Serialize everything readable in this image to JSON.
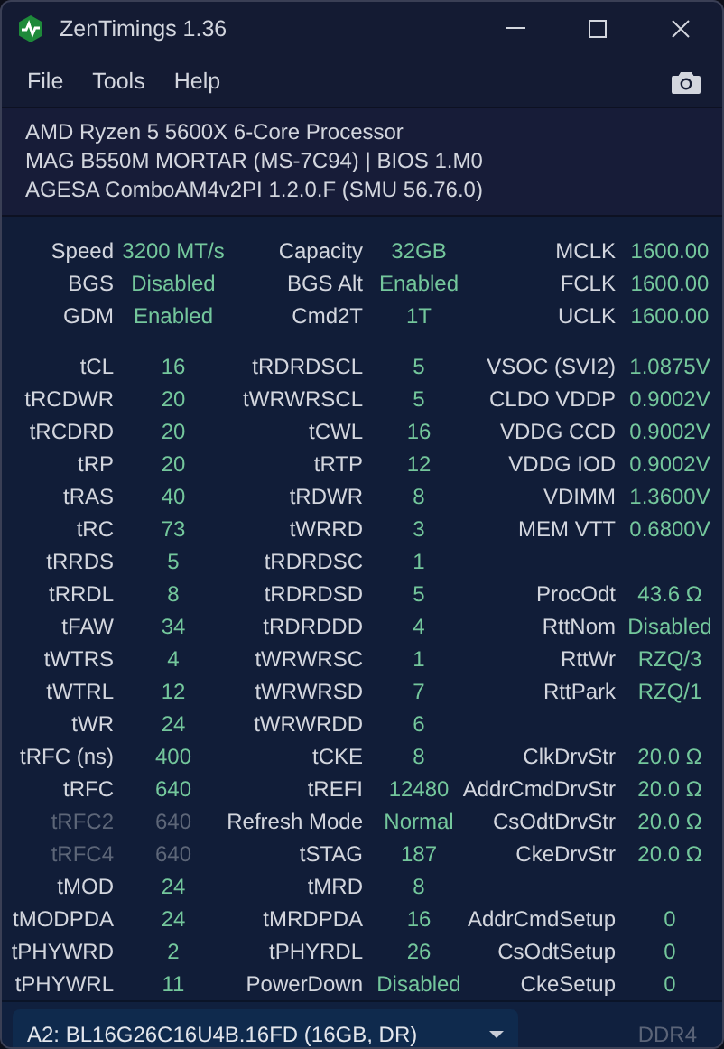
{
  "window": {
    "title": "ZenTimings 1.36"
  },
  "menu": [
    "File",
    "Tools",
    "Help"
  ],
  "system_info": [
    "AMD Ryzen 5 5600X 6-Core Processor",
    "MAG B550M MORTAR (MS-7C94) | BIOS 1.M0",
    "AGESA ComboAM4v2PI 1.2.0.F (SMU 56.76.0)"
  ],
  "summary_rows": [
    {
      "cells": [
        {
          "label": "Speed",
          "value": "3200 MT/s",
          "disabled": false
        },
        {
          "label": "Capacity",
          "value": "32GB",
          "disabled": false
        },
        {
          "label": "MCLK",
          "value": "1600.00",
          "disabled": false
        }
      ]
    },
    {
      "cells": [
        {
          "label": "BGS",
          "value": "Disabled",
          "disabled": false
        },
        {
          "label": "BGS Alt",
          "value": "Enabled",
          "disabled": false
        },
        {
          "label": "FCLK",
          "value": "1600.00",
          "disabled": false
        }
      ]
    },
    {
      "cells": [
        {
          "label": "GDM",
          "value": "Enabled",
          "disabled": false
        },
        {
          "label": "Cmd2T",
          "value": "1T",
          "disabled": false
        },
        {
          "label": "UCLK",
          "value": "1600.00",
          "disabled": false
        }
      ]
    }
  ],
  "timing_rows": [
    {
      "cells": [
        {
          "label": "tCL",
          "value": "16",
          "disabled": false
        },
        {
          "label": "tRDRDSCL",
          "value": "5",
          "disabled": false
        },
        {
          "label": "VSOC (SVI2)",
          "value": "1.0875V",
          "disabled": false
        }
      ]
    },
    {
      "cells": [
        {
          "label": "tRCDWR",
          "value": "20",
          "disabled": false
        },
        {
          "label": "tWRWRSCL",
          "value": "5",
          "disabled": false
        },
        {
          "label": "CLDO VDDP",
          "value": "0.9002V",
          "disabled": false
        }
      ]
    },
    {
      "cells": [
        {
          "label": "tRCDRD",
          "value": "20",
          "disabled": false
        },
        {
          "label": "tCWL",
          "value": "16",
          "disabled": false
        },
        {
          "label": "VDDG CCD",
          "value": "0.9002V",
          "disabled": false
        }
      ]
    },
    {
      "cells": [
        {
          "label": "tRP",
          "value": "20",
          "disabled": false
        },
        {
          "label": "tRTP",
          "value": "12",
          "disabled": false
        },
        {
          "label": "VDDG IOD",
          "value": "0.9002V",
          "disabled": false
        }
      ]
    },
    {
      "cells": [
        {
          "label": "tRAS",
          "value": "40",
          "disabled": false
        },
        {
          "label": "tRDWR",
          "value": "8",
          "disabled": false
        },
        {
          "label": "VDIMM",
          "value": "1.3600V",
          "disabled": false
        }
      ]
    },
    {
      "cells": [
        {
          "label": "tRC",
          "value": "73",
          "disabled": false
        },
        {
          "label": "tWRRD",
          "value": "3",
          "disabled": false
        },
        {
          "label": "MEM VTT",
          "value": "0.6800V",
          "disabled": false
        }
      ]
    },
    {
      "cells": [
        {
          "label": "tRRDS",
          "value": "5",
          "disabled": false
        },
        {
          "label": "tRDRDSC",
          "value": "1",
          "disabled": false
        }
      ]
    },
    {
      "cells": [
        {
          "label": "tRRDL",
          "value": "8",
          "disabled": false
        },
        {
          "label": "tRDRDSD",
          "value": "5",
          "disabled": false
        },
        {
          "label": "ProcOdt",
          "value": "43.6 Ω",
          "disabled": false
        }
      ]
    },
    {
      "cells": [
        {
          "label": "tFAW",
          "value": "34",
          "disabled": false
        },
        {
          "label": "tRDRDDD",
          "value": "4",
          "disabled": false
        },
        {
          "label": "RttNom",
          "value": "Disabled",
          "disabled": false
        }
      ]
    },
    {
      "cells": [
        {
          "label": "tWTRS",
          "value": "4",
          "disabled": false
        },
        {
          "label": "tWRWRSC",
          "value": "1",
          "disabled": false
        },
        {
          "label": "RttWr",
          "value": "RZQ/3",
          "disabled": false
        }
      ]
    },
    {
      "cells": [
        {
          "label": "tWTRL",
          "value": "12",
          "disabled": false
        },
        {
          "label": "tWRWRSD",
          "value": "7",
          "disabled": false
        },
        {
          "label": "RttPark",
          "value": "RZQ/1",
          "disabled": false
        }
      ]
    },
    {
      "cells": [
        {
          "label": "tWR",
          "value": "24",
          "disabled": false
        },
        {
          "label": "tWRWRDD",
          "value": "6",
          "disabled": false
        }
      ]
    },
    {
      "cells": [
        {
          "label": "tRFC (ns)",
          "value": "400",
          "disabled": false
        },
        {
          "label": "tCKE",
          "value": "8",
          "disabled": false
        },
        {
          "label": "ClkDrvStr",
          "value": "20.0 Ω",
          "disabled": false
        }
      ]
    },
    {
      "cells": [
        {
          "label": "tRFC",
          "value": "640",
          "disabled": false
        },
        {
          "label": "tREFI",
          "value": "12480",
          "disabled": false
        },
        {
          "label": "AddrCmdDrvStr",
          "value": "20.0 Ω",
          "disabled": false
        }
      ]
    },
    {
      "cells": [
        {
          "label": "tRFC2",
          "value": "640",
          "disabled": true
        },
        {
          "label": "Refresh Mode",
          "value": "Normal",
          "disabled": false
        },
        {
          "label": "CsOdtDrvStr",
          "value": "20.0 Ω",
          "disabled": false
        }
      ]
    },
    {
      "cells": [
        {
          "label": "tRFC4",
          "value": "640",
          "disabled": true
        },
        {
          "label": "tSTAG",
          "value": "187",
          "disabled": false
        },
        {
          "label": "CkeDrvStr",
          "value": "20.0 Ω",
          "disabled": false
        }
      ]
    },
    {
      "cells": [
        {
          "label": "tMOD",
          "value": "24",
          "disabled": false
        },
        {
          "label": "tMRD",
          "value": "8",
          "disabled": false
        }
      ]
    },
    {
      "cells": [
        {
          "label": "tMODPDA",
          "value": "24",
          "disabled": false
        },
        {
          "label": "tMRDPDA",
          "value": "16",
          "disabled": false
        },
        {
          "label": "AddrCmdSetup",
          "value": "0",
          "disabled": false
        }
      ]
    },
    {
      "cells": [
        {
          "label": "tPHYWRD",
          "value": "2",
          "disabled": false
        },
        {
          "label": "tPHYRDL",
          "value": "26",
          "disabled": false
        },
        {
          "label": "CsOdtSetup",
          "value": "0",
          "disabled": false
        }
      ]
    },
    {
      "cells": [
        {
          "label": "tPHYWRL",
          "value": "11",
          "disabled": false
        },
        {
          "label": "PowerDown",
          "value": "Disabled",
          "disabled": false
        },
        {
          "label": "CkeSetup",
          "value": "0",
          "disabled": false
        }
      ]
    }
  ],
  "module_select": {
    "value": "A2: BL16G26C16U4B.16FD (16GB, DR)"
  },
  "memory_type": "DDR4"
}
